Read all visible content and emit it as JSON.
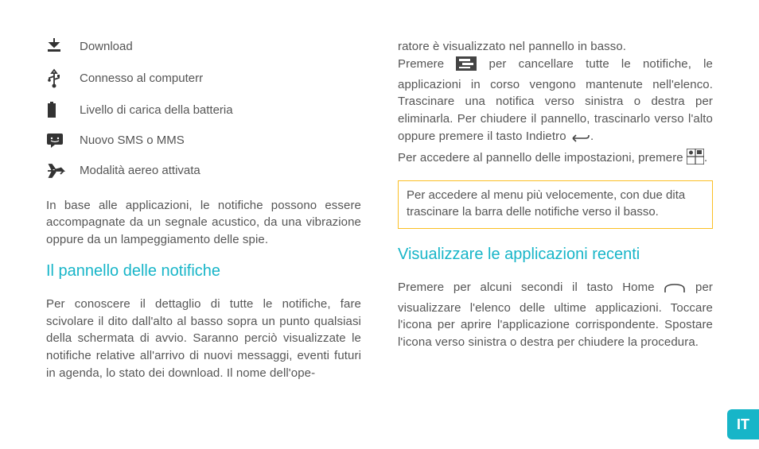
{
  "icons": [
    {
      "name": "download-icon",
      "label": "Download"
    },
    {
      "name": "usb-icon",
      "label": "Connesso al computerr"
    },
    {
      "name": "battery-icon",
      "label": "Livello di carica della batteria"
    },
    {
      "name": "sms-icon",
      "label": "Nuovo SMS o MMS"
    },
    {
      "name": "airplane-icon",
      "label": "Modalità aereo attivata"
    }
  ],
  "left": {
    "intro": "In base alle applicazioni, le notifiche possono essere accompagnate da un segnale acustico, da una vibrazione oppure da un lampeggiamento delle spie.",
    "heading": "Il pannello delle notifiche",
    "body": "Per conoscere il dettaglio di tutte le notifiche, fare scivolare il dito dall'alto al basso sopra un punto qualsiasi della schermata di avvio. Saranno perciò visualizzate le notifiche relative all'arrivo di nuovi messaggi, eventi futuri in agenda, lo stato dei download. Il nome dell'ope-"
  },
  "right": {
    "cont1": "ratore è visualizzato nel pannello in basso.",
    "press": "Premere",
    "cont2": "per cancellare tutte le notifiche,  le applicazioni in corso vengono mantenute nell'elenco. Trascinare una notifica verso sinistra o destra per eliminarla. Per chiudere il pannello, trascinarlo verso l'alto oppure premere il tasto Indietro",
    "period": ".",
    "settings1": "Per accedere al pannello delle impostazioni, premere",
    "settings2": ".",
    "tip": "Per accedere al menu più velocemente, con due dita trascinare la barra delle notifiche verso il basso.",
    "heading2": "Visualizzare le applicazioni recenti",
    "recent1": "Premere per alcuni secondi il tasto Home",
    "recent2": "per visualizzare l'elenco delle ultime applicazioni. Toccare l'icona per aprire l'applicazione corrispondente. Spostare l'icona verso sinistra o destra per chiudere la procedura."
  },
  "lang": "IT"
}
